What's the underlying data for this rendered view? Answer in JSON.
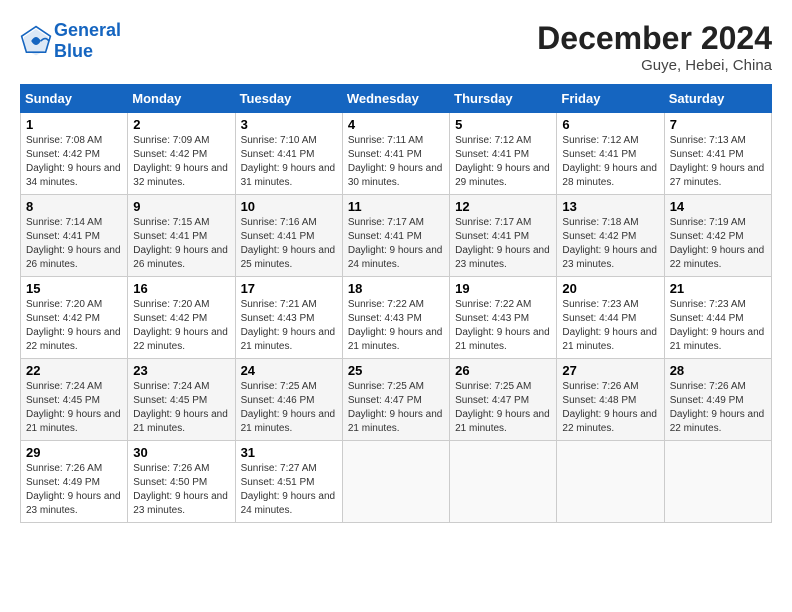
{
  "header": {
    "logo_line1": "General",
    "logo_line2": "Blue",
    "month_title": "December 2024",
    "location": "Guye, Hebei, China"
  },
  "weekdays": [
    "Sunday",
    "Monday",
    "Tuesday",
    "Wednesday",
    "Thursday",
    "Friday",
    "Saturday"
  ],
  "weeks": [
    [
      {
        "day": "1",
        "sunrise": "Sunrise: 7:08 AM",
        "sunset": "Sunset: 4:42 PM",
        "daylight": "Daylight: 9 hours and 34 minutes."
      },
      {
        "day": "2",
        "sunrise": "Sunrise: 7:09 AM",
        "sunset": "Sunset: 4:42 PM",
        "daylight": "Daylight: 9 hours and 32 minutes."
      },
      {
        "day": "3",
        "sunrise": "Sunrise: 7:10 AM",
        "sunset": "Sunset: 4:41 PM",
        "daylight": "Daylight: 9 hours and 31 minutes."
      },
      {
        "day": "4",
        "sunrise": "Sunrise: 7:11 AM",
        "sunset": "Sunset: 4:41 PM",
        "daylight": "Daylight: 9 hours and 30 minutes."
      },
      {
        "day": "5",
        "sunrise": "Sunrise: 7:12 AM",
        "sunset": "Sunset: 4:41 PM",
        "daylight": "Daylight: 9 hours and 29 minutes."
      },
      {
        "day": "6",
        "sunrise": "Sunrise: 7:12 AM",
        "sunset": "Sunset: 4:41 PM",
        "daylight": "Daylight: 9 hours and 28 minutes."
      },
      {
        "day": "7",
        "sunrise": "Sunrise: 7:13 AM",
        "sunset": "Sunset: 4:41 PM",
        "daylight": "Daylight: 9 hours and 27 minutes."
      }
    ],
    [
      {
        "day": "8",
        "sunrise": "Sunrise: 7:14 AM",
        "sunset": "Sunset: 4:41 PM",
        "daylight": "Daylight: 9 hours and 26 minutes."
      },
      {
        "day": "9",
        "sunrise": "Sunrise: 7:15 AM",
        "sunset": "Sunset: 4:41 PM",
        "daylight": "Daylight: 9 hours and 26 minutes."
      },
      {
        "day": "10",
        "sunrise": "Sunrise: 7:16 AM",
        "sunset": "Sunset: 4:41 PM",
        "daylight": "Daylight: 9 hours and 25 minutes."
      },
      {
        "day": "11",
        "sunrise": "Sunrise: 7:17 AM",
        "sunset": "Sunset: 4:41 PM",
        "daylight": "Daylight: 9 hours and 24 minutes."
      },
      {
        "day": "12",
        "sunrise": "Sunrise: 7:17 AM",
        "sunset": "Sunset: 4:41 PM",
        "daylight": "Daylight: 9 hours and 23 minutes."
      },
      {
        "day": "13",
        "sunrise": "Sunrise: 7:18 AM",
        "sunset": "Sunset: 4:42 PM",
        "daylight": "Daylight: 9 hours and 23 minutes."
      },
      {
        "day": "14",
        "sunrise": "Sunrise: 7:19 AM",
        "sunset": "Sunset: 4:42 PM",
        "daylight": "Daylight: 9 hours and 22 minutes."
      }
    ],
    [
      {
        "day": "15",
        "sunrise": "Sunrise: 7:20 AM",
        "sunset": "Sunset: 4:42 PM",
        "daylight": "Daylight: 9 hours and 22 minutes."
      },
      {
        "day": "16",
        "sunrise": "Sunrise: 7:20 AM",
        "sunset": "Sunset: 4:42 PM",
        "daylight": "Daylight: 9 hours and 22 minutes."
      },
      {
        "day": "17",
        "sunrise": "Sunrise: 7:21 AM",
        "sunset": "Sunset: 4:43 PM",
        "daylight": "Daylight: 9 hours and 21 minutes."
      },
      {
        "day": "18",
        "sunrise": "Sunrise: 7:22 AM",
        "sunset": "Sunset: 4:43 PM",
        "daylight": "Daylight: 9 hours and 21 minutes."
      },
      {
        "day": "19",
        "sunrise": "Sunrise: 7:22 AM",
        "sunset": "Sunset: 4:43 PM",
        "daylight": "Daylight: 9 hours and 21 minutes."
      },
      {
        "day": "20",
        "sunrise": "Sunrise: 7:23 AM",
        "sunset": "Sunset: 4:44 PM",
        "daylight": "Daylight: 9 hours and 21 minutes."
      },
      {
        "day": "21",
        "sunrise": "Sunrise: 7:23 AM",
        "sunset": "Sunset: 4:44 PM",
        "daylight": "Daylight: 9 hours and 21 minutes."
      }
    ],
    [
      {
        "day": "22",
        "sunrise": "Sunrise: 7:24 AM",
        "sunset": "Sunset: 4:45 PM",
        "daylight": "Daylight: 9 hours and 21 minutes."
      },
      {
        "day": "23",
        "sunrise": "Sunrise: 7:24 AM",
        "sunset": "Sunset: 4:45 PM",
        "daylight": "Daylight: 9 hours and 21 minutes."
      },
      {
        "day": "24",
        "sunrise": "Sunrise: 7:25 AM",
        "sunset": "Sunset: 4:46 PM",
        "daylight": "Daylight: 9 hours and 21 minutes."
      },
      {
        "day": "25",
        "sunrise": "Sunrise: 7:25 AM",
        "sunset": "Sunset: 4:47 PM",
        "daylight": "Daylight: 9 hours and 21 minutes."
      },
      {
        "day": "26",
        "sunrise": "Sunrise: 7:25 AM",
        "sunset": "Sunset: 4:47 PM",
        "daylight": "Daylight: 9 hours and 21 minutes."
      },
      {
        "day": "27",
        "sunrise": "Sunrise: 7:26 AM",
        "sunset": "Sunset: 4:48 PM",
        "daylight": "Daylight: 9 hours and 22 minutes."
      },
      {
        "day": "28",
        "sunrise": "Sunrise: 7:26 AM",
        "sunset": "Sunset: 4:49 PM",
        "daylight": "Daylight: 9 hours and 22 minutes."
      }
    ],
    [
      {
        "day": "29",
        "sunrise": "Sunrise: 7:26 AM",
        "sunset": "Sunset: 4:49 PM",
        "daylight": "Daylight: 9 hours and 23 minutes."
      },
      {
        "day": "30",
        "sunrise": "Sunrise: 7:26 AM",
        "sunset": "Sunset: 4:50 PM",
        "daylight": "Daylight: 9 hours and 23 minutes."
      },
      {
        "day": "31",
        "sunrise": "Sunrise: 7:27 AM",
        "sunset": "Sunset: 4:51 PM",
        "daylight": "Daylight: 9 hours and 24 minutes."
      },
      null,
      null,
      null,
      null
    ]
  ]
}
